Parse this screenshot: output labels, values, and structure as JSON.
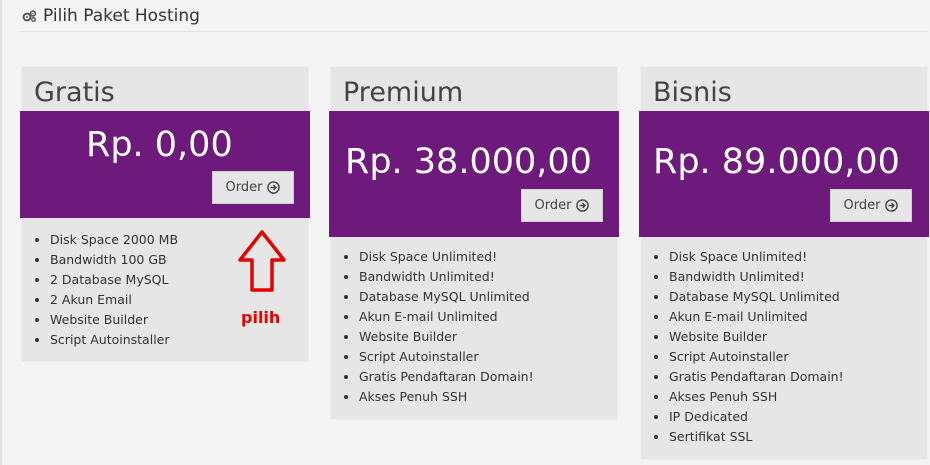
{
  "header": {
    "title": "Pilih Paket Hosting",
    "icon": "gears-icon"
  },
  "theme": {
    "accent": "#6e1a7c",
    "card_bg": "#e6e6e6",
    "hint_color": "#e60000"
  },
  "packages": [
    {
      "name": "Gratis",
      "price": "Rp. 0,00",
      "order_label": "Order",
      "features": [
        "Disk Space 2000 MB",
        "Bandwidth 100 GB",
        "2 Database MySQL",
        "2 Akun Email",
        "Website Builder",
        "Script Autoinstaller"
      ]
    },
    {
      "name": "Premium",
      "price": "Rp. 38.000,00",
      "order_label": "Order",
      "features": [
        "Disk Space Unlimited!",
        "Bandwidth Unlimited!",
        "Database MySQL Unlimited",
        "Akun E-mail Unlimited",
        "Website Builder",
        "Script Autoinstaller",
        "Gratis Pendaftaran Domain!",
        "Akses Penuh SSH"
      ]
    },
    {
      "name": "Bisnis",
      "price": "Rp. 89.000,00",
      "order_label": "Order",
      "features": [
        "Disk Space Unlimited!",
        "Bandwidth Unlimited!",
        "Database MySQL Unlimited",
        "Akun E-mail Unlimited",
        "Website Builder",
        "Script Autoinstaller",
        "Gratis Pendaftaran Domain!",
        "Akses Penuh SSH",
        "IP Dedicated",
        "Sertifikat SSL"
      ]
    }
  ],
  "annotation": {
    "label": "pilih",
    "icon": "arrow-up-icon"
  }
}
